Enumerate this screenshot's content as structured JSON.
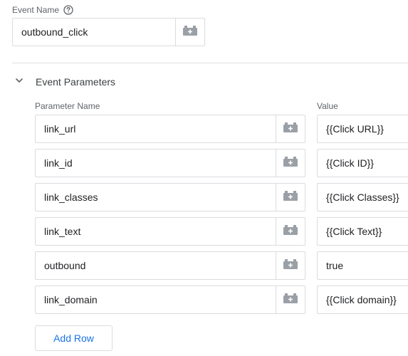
{
  "event_name": {
    "label": "Event Name",
    "value": "outbound_click"
  },
  "event_parameters": {
    "title": "Event Parameters",
    "col_parameter_name": "Parameter Name",
    "col_value": "Value",
    "rows": [
      {
        "name": "link_url",
        "value": "{{Click URL}}"
      },
      {
        "name": "link_id",
        "value": "{{Click ID}}"
      },
      {
        "name": "link_classes",
        "value": "{{Click Classes}}"
      },
      {
        "name": "link_text",
        "value": "{{Click Text}}"
      },
      {
        "name": "outbound",
        "value": "true"
      },
      {
        "name": "link_domain",
        "value": "{{Click domain}}"
      }
    ],
    "add_row_label": "Add Row"
  },
  "icons": {
    "help": "help-circle-icon",
    "variable": "variable-brick-icon",
    "collapse": "chevron-down-icon"
  },
  "colors": {
    "accent": "#1a73e8",
    "border": "#dadce0",
    "label": "#5f6368",
    "icon": "#9aa0a6"
  }
}
